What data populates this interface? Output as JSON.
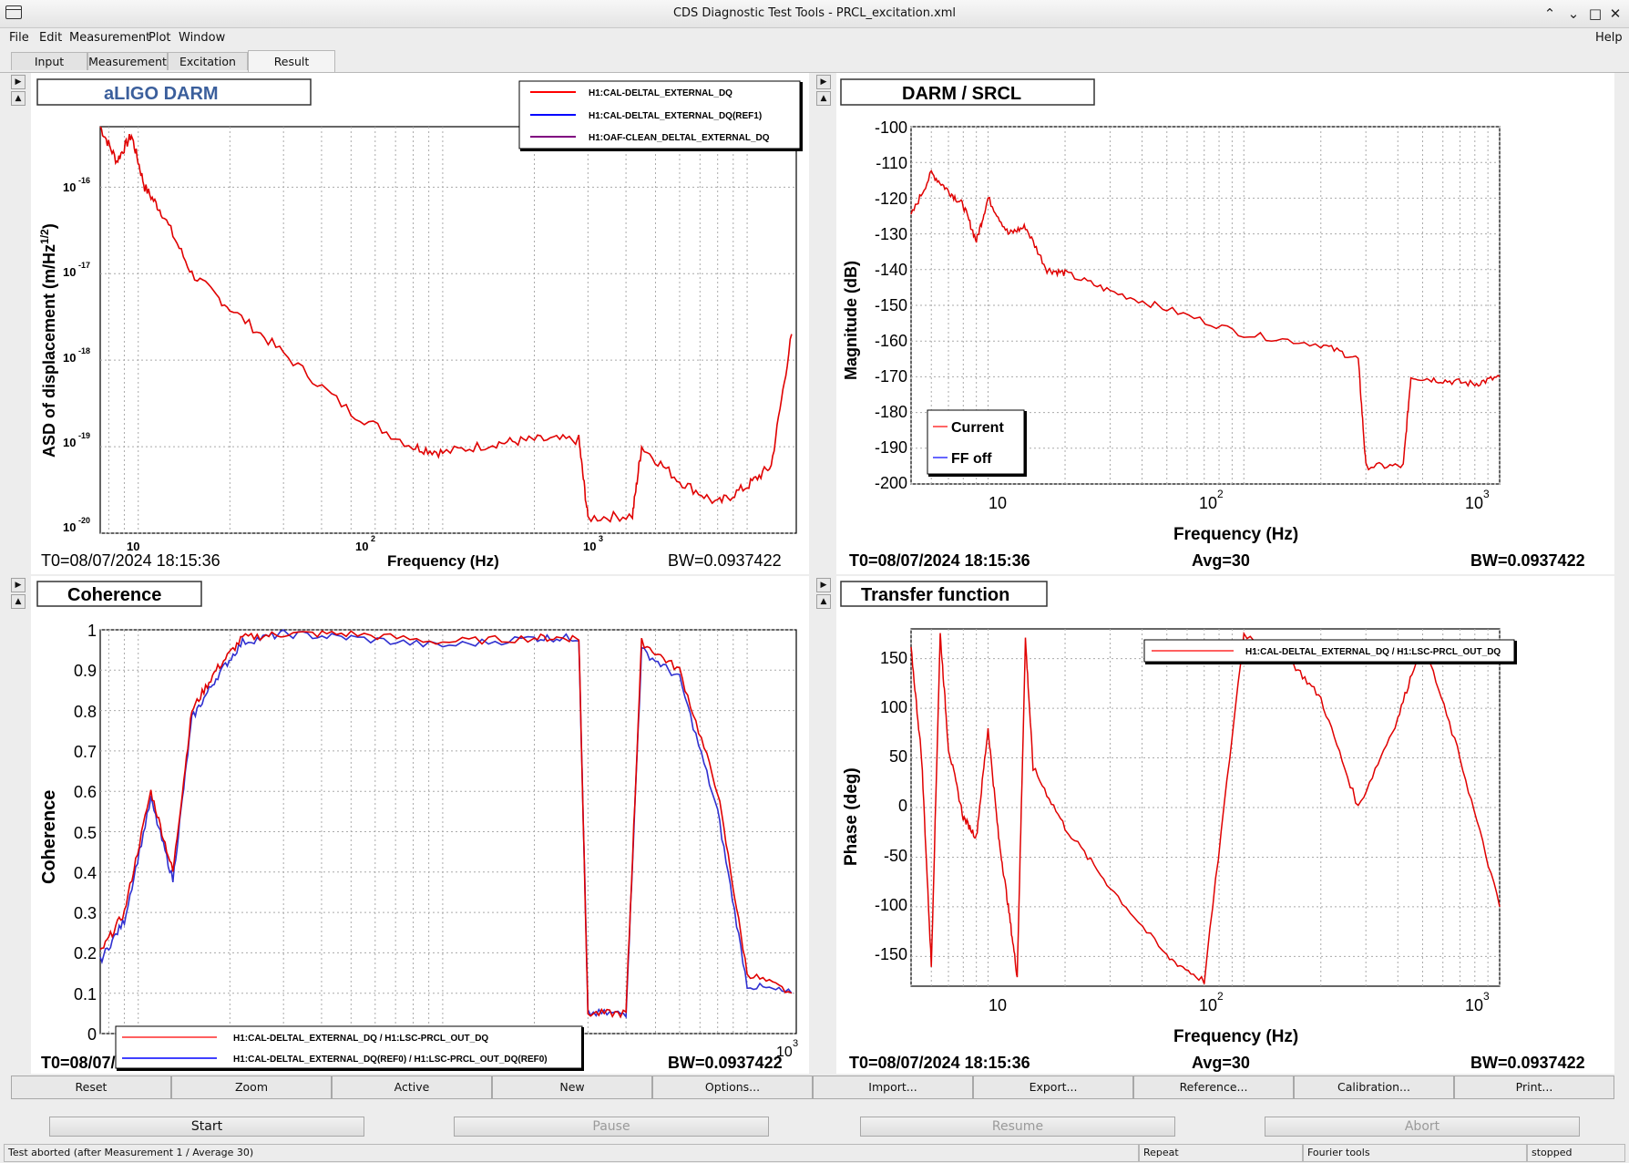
{
  "window": {
    "title": "CDS Diagnostic Test Tools - PRCL_excitation.xml",
    "controls": [
      "minimize-icon",
      "restore-icon",
      "maximize-icon",
      "close-icon"
    ]
  },
  "menu": {
    "file": "File",
    "edit": "Edit",
    "measurement": "Measurement",
    "plot": "Plot",
    "window": "Window",
    "help": "Help"
  },
  "tabs": {
    "input": "Input",
    "measurement": "Measurement",
    "excitation": "Excitation",
    "result": "Result",
    "active": "Result"
  },
  "colors": {
    "current": "#ff0000",
    "reference": "#0000ff",
    "clean": "#800080",
    "title_blue": "#3b5f9c"
  },
  "panels": {
    "tl": {
      "title": "aLIGO DARM",
      "ylabel": "ASD of displacement (m/Hz",
      "ylabel_sup": "1/2",
      "ylabel_end": ")",
      "xlabel": "Frequency (Hz)",
      "t0": "T0=08/07/2024 18:15:36",
      "bw": "BW=0.0937422",
      "legend": [
        "H1:CAL-DELTAL_EXTERNAL_DQ",
        "H1:CAL-DELTAL_EXTERNAL_DQ(REF1)",
        "H1:OAF-CLEAN_DELTAL_EXTERNAL_DQ"
      ],
      "yticks": [
        "10",
        "-16",
        "10",
        "-17",
        "10",
        "-18",
        "10",
        "-19",
        "10",
        "-20"
      ],
      "xticks": [
        "10",
        "10",
        "2",
        "10",
        "3"
      ]
    },
    "tr": {
      "title": "DARM / SRCL",
      "ylabel": "Magnitude (dB)",
      "xlabel": "Frequency (Hz)",
      "t0": "T0=08/07/2024 18:15:36",
      "avg": "Avg=30",
      "bw": "BW=0.0937422",
      "legend": [
        "Current",
        "FF off"
      ],
      "yticks": [
        "-100",
        "-110",
        "-120",
        "-130",
        "-140",
        "-150",
        "-160",
        "-170",
        "-180",
        "-190",
        "-200"
      ],
      "xticks": [
        "10",
        "10",
        "2",
        "10",
        "3"
      ]
    },
    "bl": {
      "title": "Coherence",
      "ylabel": "Coherence",
      "t0": "T0=08/07/2024 18:15:36",
      "bw": "BW=0.0937422",
      "legend": [
        "H1:CAL-DELTAL_EXTERNAL_DQ / H1:LSC-PRCL_OUT_DQ",
        "H1:CAL-DELTAL_EXTERNAL_DQ(REF0) / H1:LSC-PRCL_OUT_DQ(REF0)"
      ],
      "yticks": [
        "1",
        "0.9",
        "0.8",
        "0.7",
        "0.6",
        "0.5",
        "0.4",
        "0.3",
        "0.2",
        "0.1",
        "0"
      ],
      "xticks": [
        "10",
        "3"
      ]
    },
    "br": {
      "title": "Transfer function",
      "ylabel": "Phase (deg)",
      "xlabel": "Frequency (Hz)",
      "t0": "T0=08/07/2024 18:15:36",
      "avg": "Avg=30",
      "bw": "BW=0.0937422",
      "legend": [
        "H1:CAL-DELTAL_EXTERNAL_DQ / H1:LSC-PRCL_OUT_DQ"
      ],
      "yticks": [
        "150",
        "100",
        "50",
        "0",
        "-50",
        "-100",
        "-150"
      ],
      "xticks": [
        "10",
        "10",
        "2",
        "10",
        "3"
      ]
    }
  },
  "chart_data": [
    {
      "type": "line",
      "title": "aLIGO DARM",
      "xlabel": "Frequency (Hz)",
      "ylabel": "ASD of displacement (m/Hz^1/2)",
      "xscale": "log",
      "yscale": "log",
      "xlim": [
        7.5,
        1450
      ],
      "ylim": [
        1e-20,
        5e-16
      ],
      "series": [
        {
          "name": "H1:CAL-DELTAL_EXTERNAL_DQ",
          "x": [
            7.5,
            8.5,
            9.5,
            10.5,
            12,
            15,
            20,
            30,
            50,
            80,
            100,
            150,
            200,
            280,
            300,
            420,
            450,
            600,
            800,
            1000,
            1200,
            1400
          ],
          "y": [
            5e-16,
            2e-16,
            4e-16,
            1e-16,
            5e-17,
            1e-17,
            4e-18,
            1.2e-18,
            2.5e-19,
            1e-19,
            8.5e-20,
            1.1e-19,
            1.2e-19,
            1.2e-19,
            1.5e-20,
            1.6e-20,
            1e-19,
            4e-20,
            2.2e-20,
            3.5e-20,
            6e-20,
            2e-18
          ]
        }
      ],
      "grid": true,
      "legend_position": "top-right"
    },
    {
      "type": "line",
      "title": "DARM / SRCL",
      "xlabel": "Frequency (Hz)",
      "ylabel": "Magnitude (dB)",
      "xscale": "log",
      "xlim": [
        5,
        1000
      ],
      "ylim": [
        -200,
        -100
      ],
      "series": [
        {
          "name": "Current",
          "x": [
            5,
            6,
            7,
            8,
            9,
            10,
            12,
            14,
            17,
            20,
            30,
            50,
            100,
            200,
            280,
            300,
            420,
            450,
            600,
            800,
            1000
          ],
          "y": [
            -125,
            -113,
            -118,
            -122,
            -132,
            -120,
            -130,
            -128,
            -140,
            -141,
            -146,
            -151,
            -158,
            -161,
            -165,
            -195,
            -195,
            -170,
            -171,
            -172,
            -170
          ]
        }
      ],
      "grid": true,
      "legend_position": "bottom-left"
    },
    {
      "type": "line",
      "title": "Coherence",
      "ylabel": "Coherence",
      "xscale": "log",
      "xlim": [
        7.5,
        1450
      ],
      "ylim": [
        0,
        1
      ],
      "series": [
        {
          "name": "H1:CAL-DELTAL_EXTERNAL_DQ / H1:LSC-PRCL_OUT_DQ",
          "x": [
            7.5,
            9,
            11,
            13,
            15,
            18,
            22,
            30,
            50,
            100,
            200,
            280,
            300,
            400,
            450,
            600,
            800,
            1000,
            1400
          ],
          "y": [
            0.2,
            0.3,
            0.6,
            0.4,
            0.8,
            0.9,
            0.98,
            0.99,
            0.99,
            0.97,
            0.98,
            0.98,
            0.05,
            0.05,
            0.97,
            0.9,
            0.6,
            0.15,
            0.1
          ]
        },
        {
          "name": "H1:CAL-DELTAL_EXTERNAL_DQ(REF0) / H1:LSC-PRCL_OUT_DQ(REF0)",
          "x": [
            7.5,
            9,
            11,
            13,
            15,
            18,
            22,
            30,
            50,
            100,
            200,
            280,
            300,
            400,
            450,
            600,
            800,
            1000,
            1400
          ],
          "y": [
            0.18,
            0.28,
            0.58,
            0.38,
            0.78,
            0.88,
            0.97,
            0.99,
            0.98,
            0.96,
            0.98,
            0.98,
            0.05,
            0.05,
            0.95,
            0.88,
            0.55,
            0.12,
            0.1
          ]
        }
      ],
      "grid": true,
      "legend_position": "bottom"
    },
    {
      "type": "line",
      "title": "Transfer function",
      "xlabel": "Frequency (Hz)",
      "ylabel": "Phase (deg)",
      "xscale": "log",
      "xlim": [
        5,
        1000
      ],
      "ylim": [
        -180,
        180
      ],
      "series": [
        {
          "name": "H1:CAL-DELTAL_EXTERNAL_DQ / H1:LSC-PRCL_OUT_DQ",
          "x": [
            5,
            5.5,
            6,
            6.5,
            7,
            8,
            9,
            10,
            11,
            12,
            13,
            14,
            15,
            20,
            30,
            50,
            70,
            100,
            150,
            200,
            280,
            400,
            500,
            700,
            1000
          ],
          "y": [
            160,
            50,
            -160,
            175,
            60,
            -10,
            -30,
            80,
            -30,
            -100,
            -170,
            170,
            40,
            -20,
            -80,
            -150,
            -175,
            175,
            150,
            110,
            0,
            90,
            170,
            50,
            -100
          ]
        }
      ],
      "grid": true,
      "legend_position": "top-right"
    }
  ],
  "toolbar": {
    "reset": "Reset",
    "zoom": "Zoom",
    "active": "Active",
    "new": "New",
    "options": "Options...",
    "import": "Import...",
    "export": "Export...",
    "reference": "Reference...",
    "calibration": "Calibration...",
    "print": "Print..."
  },
  "controls": {
    "start": "Start",
    "pause": "Pause",
    "resume": "Resume",
    "abort": "Abort"
  },
  "status": {
    "message": "Test aborted (after Measurement 1 / Average 30)",
    "repeat": "Repeat",
    "fourier": "Fourier tools",
    "state": "stopped"
  }
}
